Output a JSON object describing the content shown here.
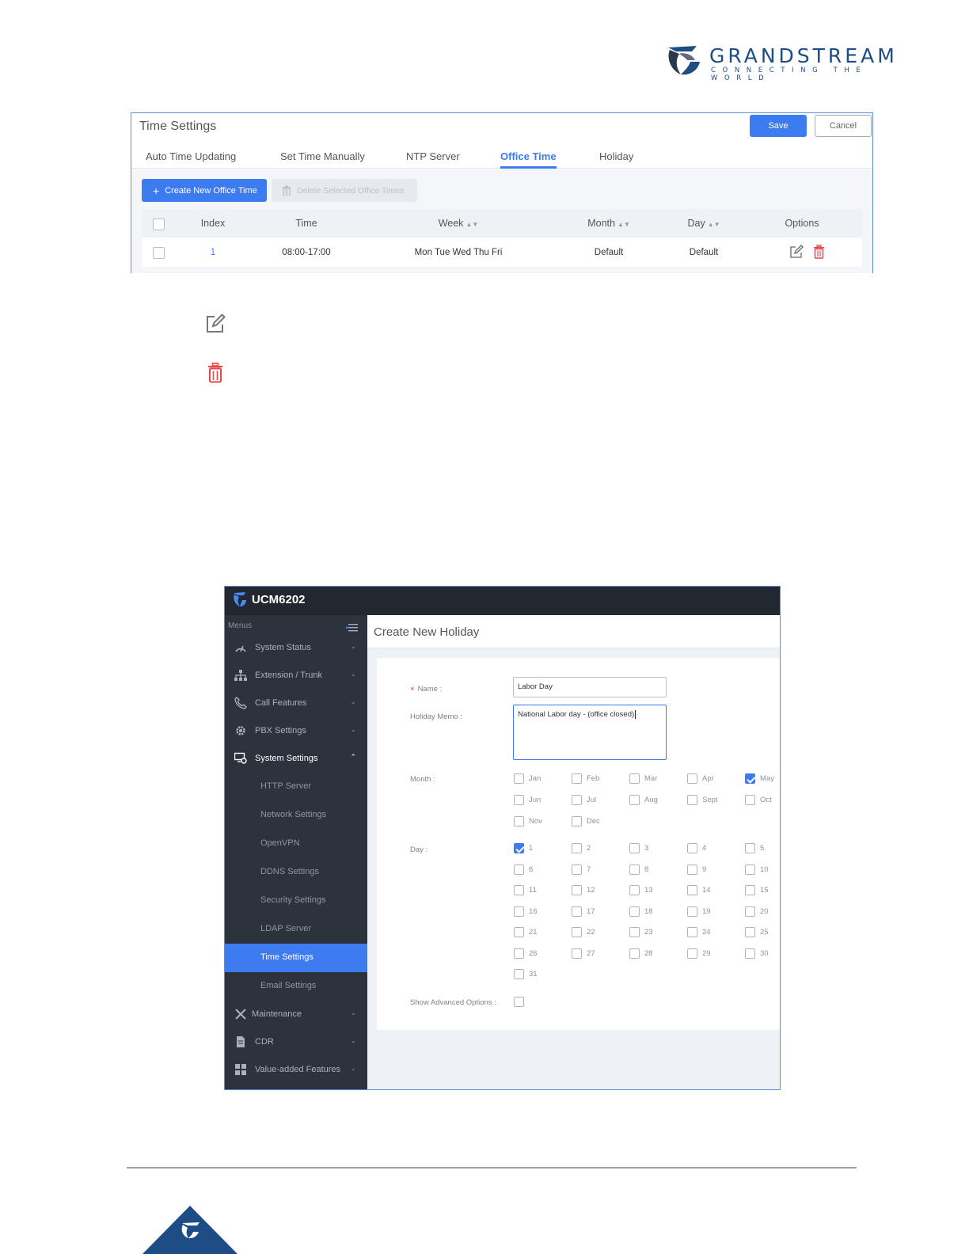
{
  "header": {
    "brand": "GRANDSTREAM",
    "tagline": "CONNECTING THE WORLD",
    "colors": {
      "brand_blue": "#1d4d84"
    }
  },
  "time_settings": {
    "title": "Time Settings",
    "save_label": "Save",
    "cancel_label": "Cancel",
    "tabs": [
      {
        "label": "Auto Time Updating",
        "active": false
      },
      {
        "label": "Set Time Manually",
        "active": false
      },
      {
        "label": "NTP Server",
        "active": false
      },
      {
        "label": "Office Time",
        "active": true
      },
      {
        "label": "Holiday",
        "active": false
      }
    ],
    "create_label": "Create New Office Time",
    "delete_label": "Delete Selected Office Times",
    "columns": [
      "Index",
      "Time",
      "Week",
      "Month",
      "Day",
      "Options"
    ],
    "rows": [
      {
        "index": "1",
        "time": "08:00-17:00",
        "week": "Mon Tue Wed Thu Fri",
        "month": "Default",
        "day": "Default"
      }
    ],
    "colors": {
      "accent": "#3d7bf0",
      "delete_red": "#e8474a"
    }
  },
  "icons": {
    "edit": "edit-icon",
    "delete": "trash-icon"
  },
  "ucm": {
    "device": "UCM6202",
    "menus_label": "Menus",
    "menu": [
      {
        "label": "System Status",
        "icon": "gauge-icon",
        "open": false
      },
      {
        "label": "Extension / Trunk",
        "icon": "network-icon",
        "open": false
      },
      {
        "label": "Call Features",
        "icon": "phone-icon",
        "open": false
      },
      {
        "label": "PBX Settings",
        "icon": "gear-icon",
        "open": false
      },
      {
        "label": "System Settings",
        "icon": "monitor-gear-icon",
        "open": true
      }
    ],
    "submenu": [
      {
        "label": "HTTP Server",
        "active": false
      },
      {
        "label": "Network Settings",
        "active": false
      },
      {
        "label": "OpenVPN",
        "active": false
      },
      {
        "label": "DDNS Settings",
        "active": false
      },
      {
        "label": "Security Settings",
        "active": false
      },
      {
        "label": "LDAP Server",
        "active": false
      },
      {
        "label": "Time Settings",
        "active": true
      },
      {
        "label": "Email Settings",
        "active": false
      }
    ],
    "menu_bottom": [
      {
        "label": "Maintenance",
        "icon": "tools-icon"
      },
      {
        "label": "CDR",
        "icon": "document-icon"
      },
      {
        "label": "Value-added Features",
        "icon": "grid-icon"
      }
    ],
    "form": {
      "title": "Create New Holiday",
      "name_label": "Name :",
      "name_value": "Labor Day",
      "memo_label": "Holiday Memo :",
      "memo_value": "National Labor day - (office closed)",
      "month_label": "Month :",
      "months": [
        {
          "label": "Jan",
          "checked": false
        },
        {
          "label": "Feb",
          "checked": false
        },
        {
          "label": "Mar",
          "checked": false
        },
        {
          "label": "Apr",
          "checked": false
        },
        {
          "label": "May",
          "checked": true
        },
        {
          "label": "Jun",
          "checked": false
        },
        {
          "label": "Jul",
          "checked": false
        },
        {
          "label": "Aug",
          "checked": false
        },
        {
          "label": "Sept",
          "checked": false
        },
        {
          "label": "Oct",
          "checked": false
        },
        {
          "label": "Nov",
          "checked": false
        },
        {
          "label": "Dec",
          "checked": false
        }
      ],
      "day_label": "Day :",
      "days": [
        {
          "label": "1",
          "checked": true
        },
        {
          "label": "2",
          "checked": false
        },
        {
          "label": "3",
          "checked": false
        },
        {
          "label": "4",
          "checked": false
        },
        {
          "label": "5",
          "checked": false
        },
        {
          "label": "6",
          "checked": false
        },
        {
          "label": "7",
          "checked": false
        },
        {
          "label": "8",
          "checked": false
        },
        {
          "label": "9",
          "checked": false
        },
        {
          "label": "10",
          "checked": false
        },
        {
          "label": "11",
          "checked": false
        },
        {
          "label": "12",
          "checked": false
        },
        {
          "label": "13",
          "checked": false
        },
        {
          "label": "14",
          "checked": false
        },
        {
          "label": "15",
          "checked": false
        },
        {
          "label": "16",
          "checked": false
        },
        {
          "label": "17",
          "checked": false
        },
        {
          "label": "18",
          "checked": false
        },
        {
          "label": "19",
          "checked": false
        },
        {
          "label": "20",
          "checked": false
        },
        {
          "label": "21",
          "checked": false
        },
        {
          "label": "22",
          "checked": false
        },
        {
          "label": "23",
          "checked": false
        },
        {
          "label": "24",
          "checked": false
        },
        {
          "label": "25",
          "checked": false
        },
        {
          "label": "26",
          "checked": false
        },
        {
          "label": "27",
          "checked": false
        },
        {
          "label": "28",
          "checked": false
        },
        {
          "label": "29",
          "checked": false
        },
        {
          "label": "30",
          "checked": false
        },
        {
          "label": "31",
          "checked": false
        }
      ],
      "advanced_label": "Show Advanced Options :"
    },
    "colors": {
      "sidebar": "#2d333d",
      "topbar": "#23272f",
      "accent": "#3d7bf0"
    }
  }
}
